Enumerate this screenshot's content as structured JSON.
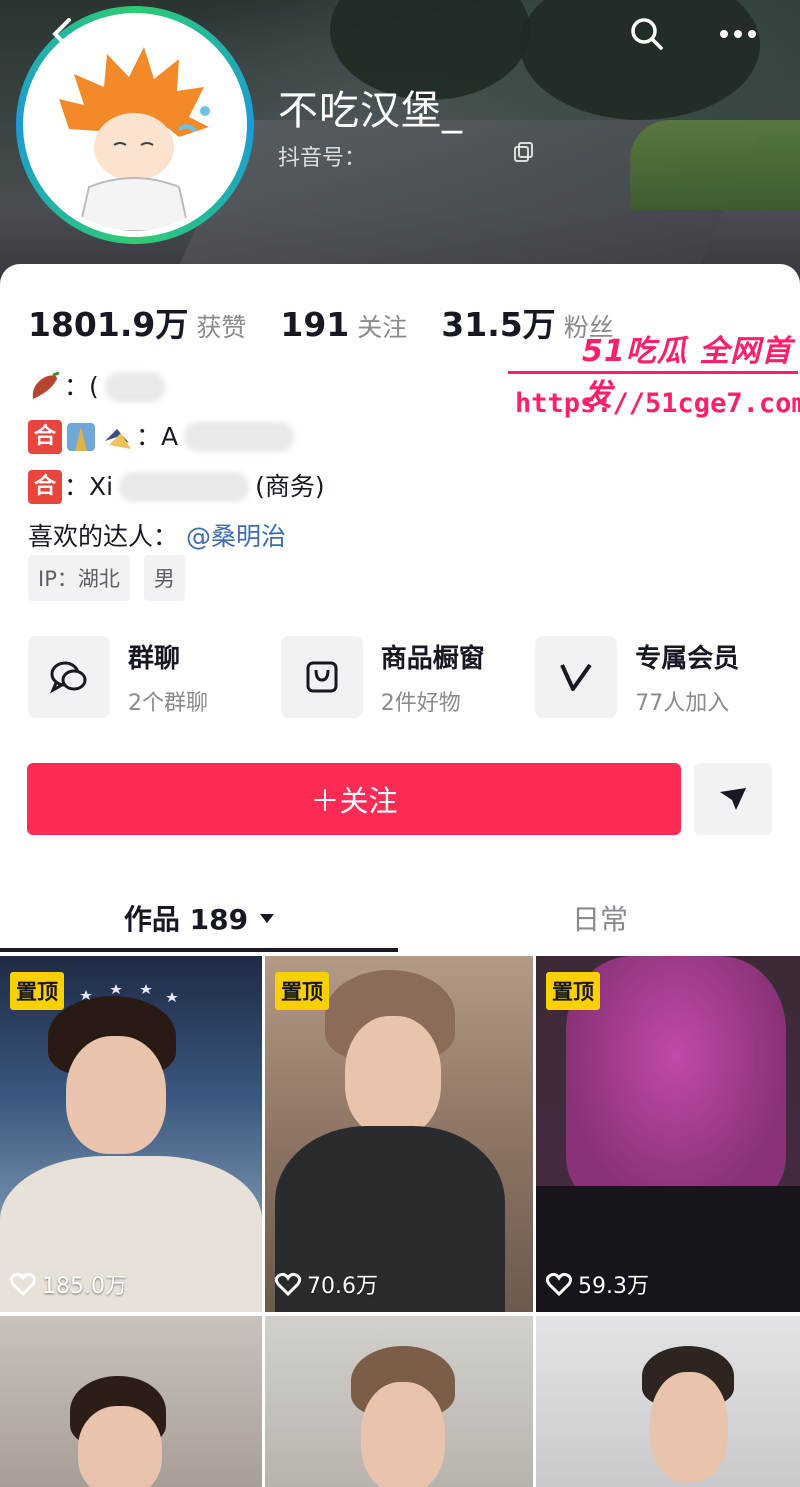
{
  "header": {
    "username": "不吃汉堡_",
    "douyin_id_label": "抖音号："
  },
  "stats": [
    {
      "num": "1801.9万",
      "label": "获赞"
    },
    {
      "num": "191",
      "label": "关注"
    },
    {
      "num": "31.5万",
      "label": "粉丝"
    }
  ],
  "bio": {
    "line1_prefix": "：(",
    "line2_text": "：A",
    "line3_badge": "合",
    "line2_badge": "合",
    "line3_text_a": "：Xi",
    "line3_text_b": "(商务)",
    "liked_label": "喜欢的达人：",
    "liked_mention": "@桑明治"
  },
  "tags": [
    "IP：湖北",
    "男"
  ],
  "features": [
    {
      "icon": "group-chat-icon",
      "title": "群聊",
      "sub": "2个群聊"
    },
    {
      "icon": "shop-bag-icon",
      "title": "商品橱窗",
      "sub": "2件好物"
    },
    {
      "icon": "vip-icon",
      "title": "专属会员",
      "sub": "77人加入"
    }
  ],
  "actions": {
    "follow_label": "＋关注",
    "share_icon": "share-arrow-icon"
  },
  "tabs": {
    "works": "作品 189",
    "daily": "日常"
  },
  "videos": [
    {
      "pinned": "置顶",
      "likes": "185.0万"
    },
    {
      "pinned": "置顶",
      "likes": "70.6万"
    },
    {
      "pinned": "置顶",
      "likes": "59.3万"
    }
  ],
  "watermark": {
    "top": "51吃瓜 全网首发",
    "url": "https://51cge7.com"
  },
  "colors": {
    "accent": "#fe2c55",
    "pin": "#fbd000",
    "mention": "#3f6db5",
    "watermark": "#ff1f6b"
  }
}
